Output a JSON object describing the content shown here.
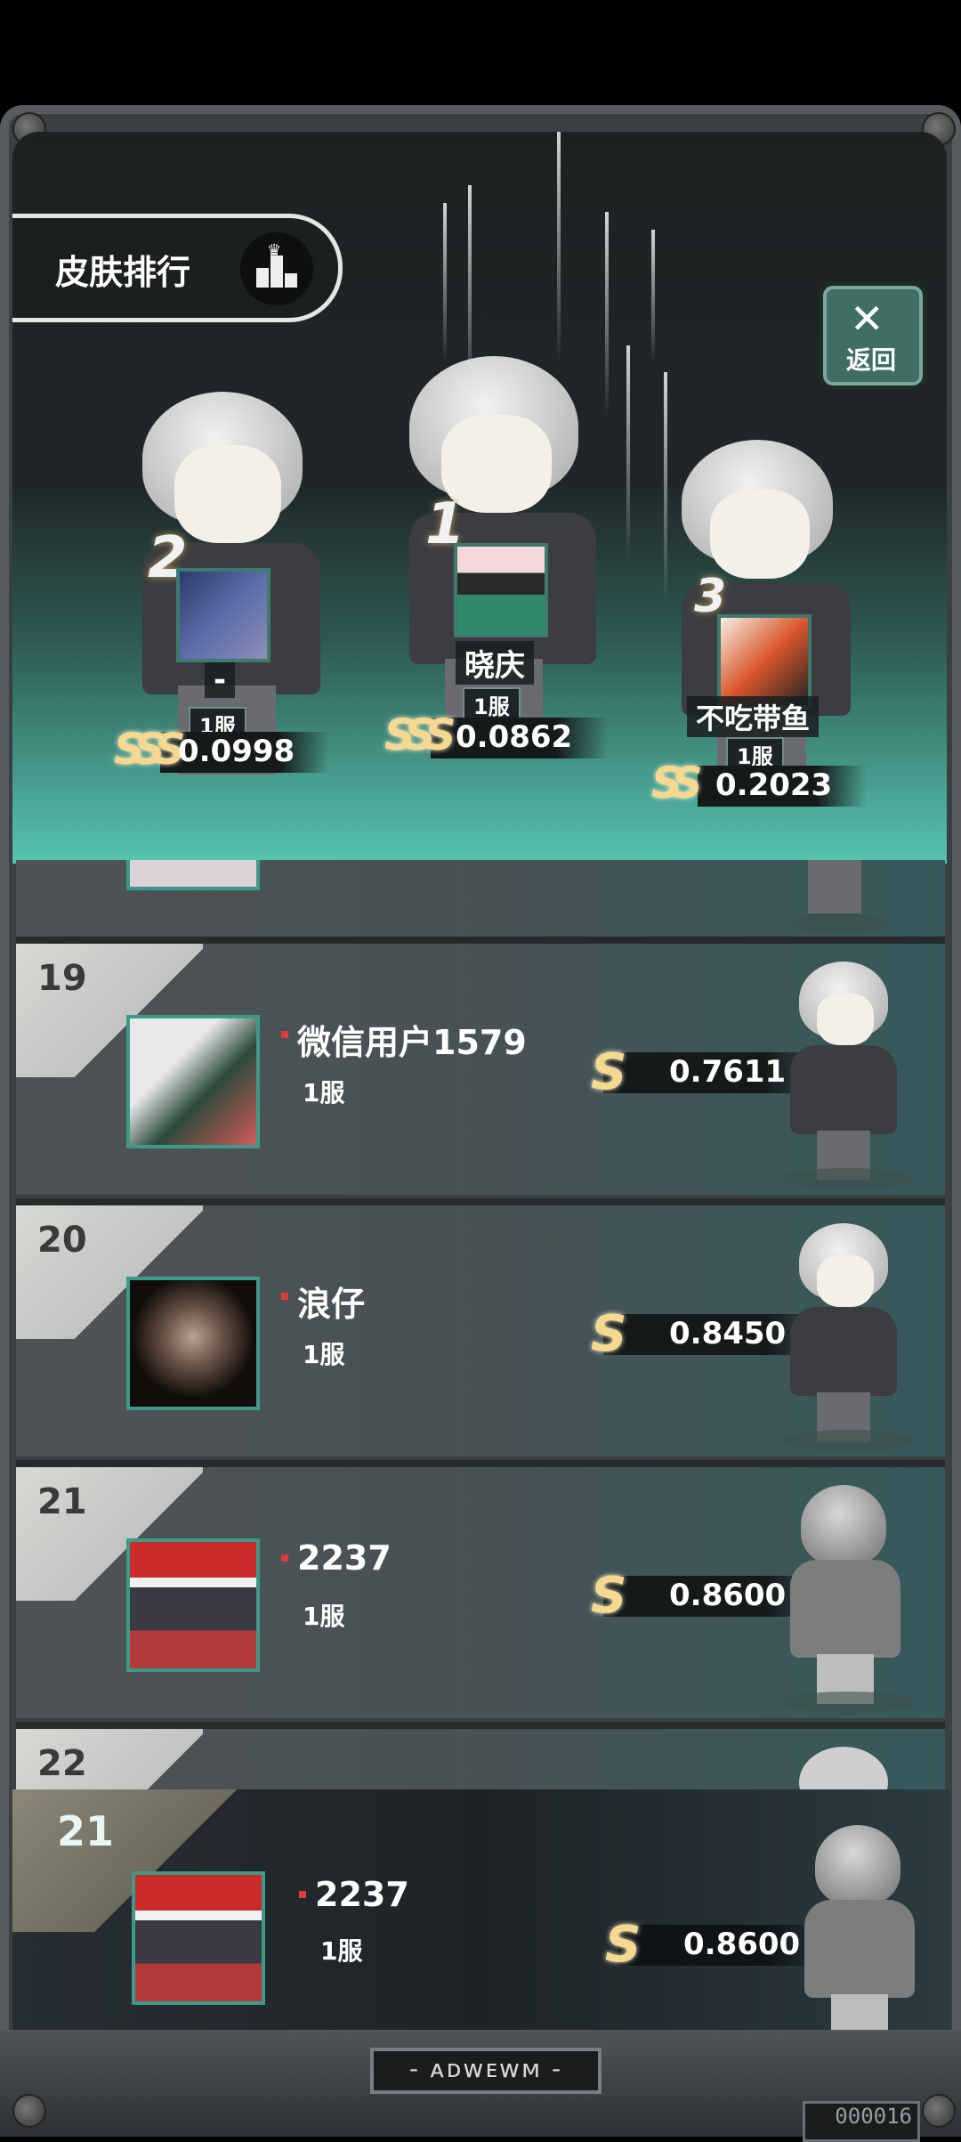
{
  "header": {
    "title": "皮肤排行",
    "back_label": "返回",
    "back_symbol": "✕"
  },
  "podium": [
    {
      "rank": "2",
      "name": "-",
      "server": "1服",
      "score": "0.0998",
      "badge": "SSS"
    },
    {
      "rank": "1",
      "name": "晓庆",
      "server": "1服",
      "score": "0.0862",
      "badge": "SSS"
    },
    {
      "rank": "3",
      "name": "不吃带鱼",
      "server": "1服",
      "score": "0.2023",
      "badge": "SS"
    }
  ],
  "list": [
    {
      "rank": "19",
      "name": "微信用户1579",
      "server": "1服",
      "score": "0.7611",
      "badge": "S"
    },
    {
      "rank": "20",
      "name": "浪仔",
      "server": "1服",
      "score": "0.8450",
      "badge": "S"
    },
    {
      "rank": "21",
      "name": "2237",
      "server": "1服",
      "score": "0.8600",
      "badge": "S"
    },
    {
      "rank": "22"
    }
  ],
  "self": {
    "rank": "21",
    "name": "2237",
    "server": "1服",
    "score": "0.8600",
    "badge": "S"
  },
  "footer": {
    "plate": "- ᴀᴅᴡᴇᴡᴍ -",
    "counter": "000016"
  },
  "colors": {
    "accent": "#57c5b0",
    "badge_gold": "#f5d990",
    "avatar_border": "#3d9a88"
  }
}
